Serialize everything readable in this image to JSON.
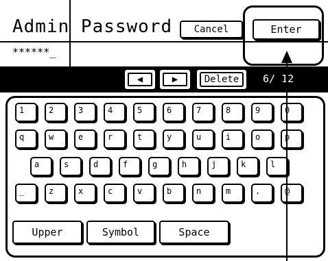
{
  "header": {
    "title": "Admin Password",
    "cancel_label": "Cancel",
    "enter_label": "Enter"
  },
  "password_field": {
    "value": "******_"
  },
  "toolbar": {
    "left_arrow": "◀",
    "right_arrow": "▶",
    "delete_label": "Delete",
    "counter": "6/ 12"
  },
  "keyboard": {
    "rows": [
      [
        "1",
        "2",
        "3",
        "4",
        "5",
        "6",
        "7",
        "8",
        "9",
        "0"
      ],
      [
        "q",
        "w",
        "e",
        "r",
        "t",
        "y",
        "u",
        "i",
        "o",
        "p"
      ],
      [
        "a",
        "s",
        "d",
        "f",
        "g",
        "h",
        "j",
        "k",
        "l"
      ],
      [
        "_",
        "z",
        "x",
        "c",
        "v",
        "b",
        "n",
        "m",
        ".",
        "@"
      ]
    ],
    "bottom": {
      "upper_label": "Upper",
      "symbol_label": "Symbol",
      "space_label": "Space"
    }
  }
}
